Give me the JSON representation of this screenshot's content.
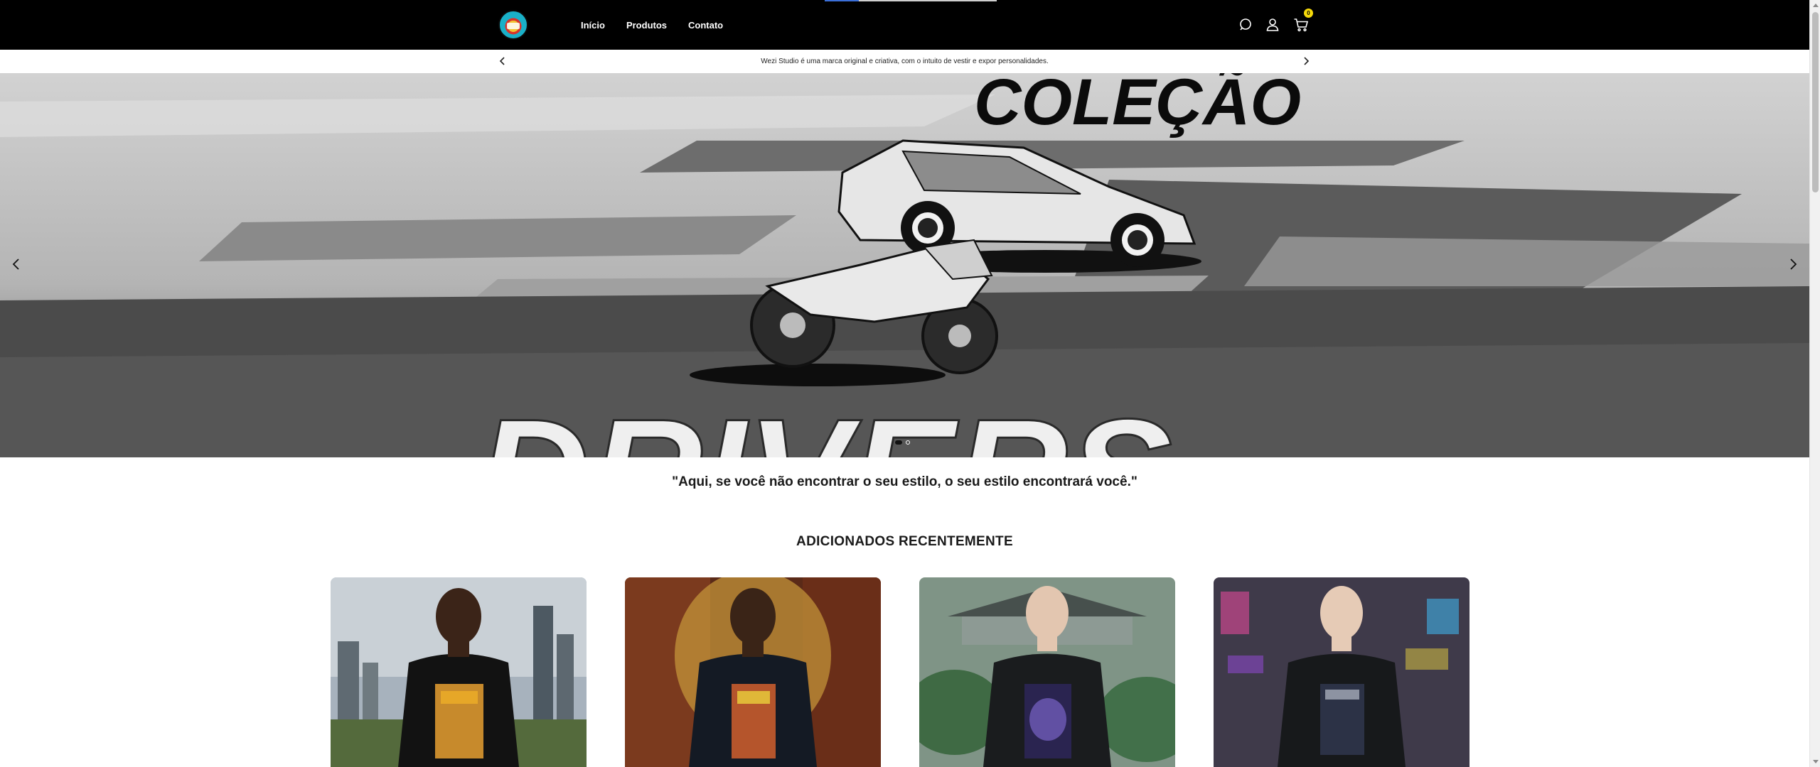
{
  "header": {
    "logo_name": "wezi-studio-logo",
    "nav": [
      "Início",
      "Produtos",
      "Contato"
    ],
    "icons": [
      "search-icon",
      "account-icon",
      "cart-icon"
    ],
    "cart_count": "0",
    "colors": {
      "background": "#000000",
      "text": "#ffffff",
      "badge": "#f5d90a"
    }
  },
  "announcement": {
    "text": "Wezi Studio é uma marca original e criativa, com o intuito de vestir e expor personalidades."
  },
  "hero": {
    "title_top": "COLEÇÃO",
    "title_bottom": "DRIVERS",
    "slides_total": 2,
    "active_slide": 1
  },
  "tagline": "\"Aqui, se você não encontrar o seu estilo, o seu estilo encontrará você.\"",
  "recent": {
    "title": "ADICIONADOS RECENTEMENTE",
    "products": [
      {
        "image": "naruto-oversized-tshirt-photo"
      },
      {
        "image": "dragon-ball-oversized-tshirt-photo"
      },
      {
        "image": "anime-portal-oversized-tshirt-photo"
      },
      {
        "image": "neon-city-anime-oversized-tshirt-photo"
      }
    ]
  }
}
